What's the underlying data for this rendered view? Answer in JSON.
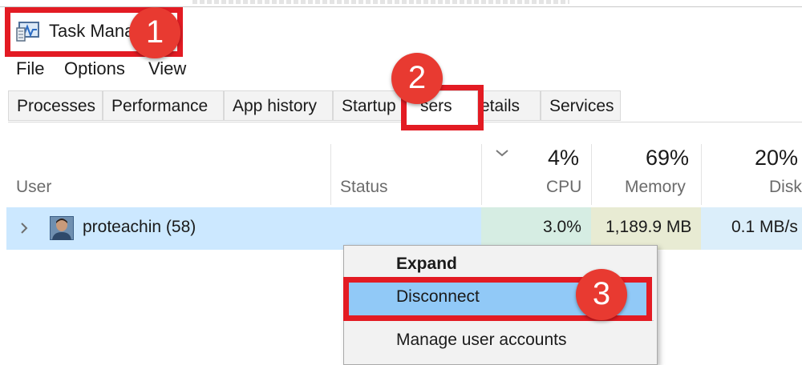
{
  "window": {
    "title": "Task Mana",
    "icon": "task-manager-icon"
  },
  "menubar": {
    "items": [
      {
        "label": "File"
      },
      {
        "label": "Options"
      },
      {
        "label": "View"
      }
    ]
  },
  "tabs": [
    {
      "label": "Processes"
    },
    {
      "label": "Performance"
    },
    {
      "label": "App history"
    },
    {
      "label": "Startup"
    },
    {
      "label": "Users",
      "visible_text": "sers",
      "active": true
    },
    {
      "label": "Details",
      "visible_text": "etails"
    },
    {
      "label": "Services"
    }
  ],
  "columns": {
    "user": {
      "label": "User"
    },
    "status": {
      "label": "Status"
    },
    "cpu": {
      "pct": "4%",
      "label": "CPU"
    },
    "memory": {
      "pct": "69%",
      "label": "Memory"
    },
    "disk": {
      "pct": "20%",
      "label": "Disk"
    }
  },
  "row": {
    "user": "proteachin (58)",
    "status": "",
    "cpu": "3.0%",
    "memory": "1,189.9 MB",
    "disk": "0.1 MB/s"
  },
  "context_menu": {
    "items": [
      {
        "label": "Expand",
        "bold": true
      },
      {
        "label": "Disconnect",
        "highlighted": true
      },
      {
        "label": "Manage user accounts"
      }
    ]
  },
  "annotations": {
    "step1": "1",
    "step2": "2",
    "step3": "3"
  },
  "colors": {
    "row_selected": "#cce8ff",
    "cpu_heat": "#d6ede3",
    "memory_heat": "#e8ebd3",
    "menu_highlight": "#91c9f7",
    "annotation_red": "#e31b23"
  }
}
